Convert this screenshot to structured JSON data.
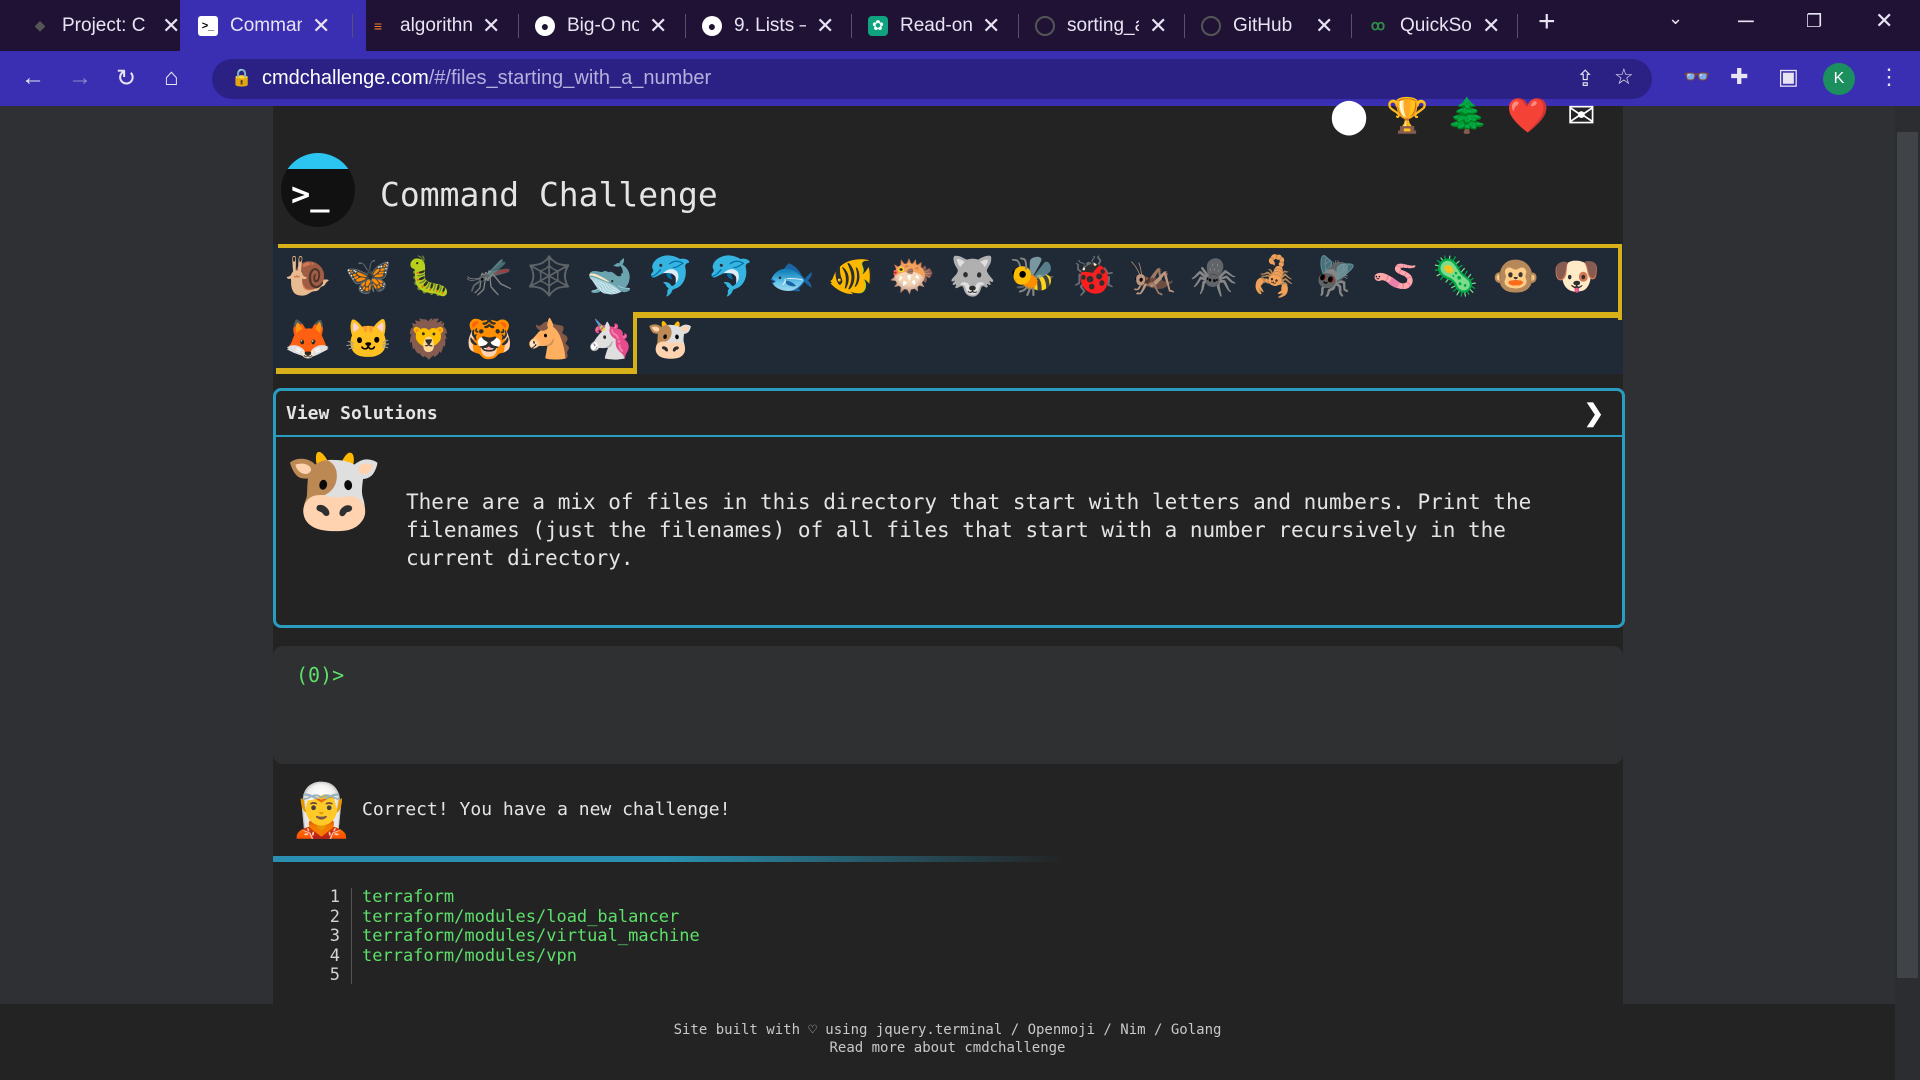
{
  "browser": {
    "tabs": [
      {
        "title": "Project: C",
        "favicon": "project-icon"
      },
      {
        "title": "Comman",
        "favicon": "terminal-icon",
        "active": true
      },
      {
        "title": "algorithn",
        "favicon": "stackoverflow-icon"
      },
      {
        "title": "Big-O no",
        "favicon": "globe-icon"
      },
      {
        "title": "9. Lists –",
        "favicon": "globe-icon"
      },
      {
        "title": "Read-onl",
        "favicon": "openai-icon"
      },
      {
        "title": "sorting_a",
        "favicon": "github-icon"
      },
      {
        "title": "GitHub",
        "favicon": "github-icon"
      },
      {
        "title": "QuickSor",
        "favicon": "geeksforgeeks-icon"
      }
    ],
    "new_tab": "+",
    "url": {
      "host": "cmdchallenge.com",
      "path": "/#/files_starting_with_a_number"
    },
    "profile_initial": "K",
    "colors": {
      "tab_strip": "#1f1235",
      "toolbar": "#3a2fb2",
      "omnibox": "#2b2185"
    }
  },
  "page": {
    "title": "Command Challenge",
    "logo_prompt": ">_",
    "top_icons": [
      "terminal-logo-icon",
      "trophy-hand-icon",
      "tree-icon",
      "heart-icon",
      "envelope-icon"
    ],
    "animals_row1": [
      "🐌",
      "🦋",
      "🐛",
      "🦟",
      "🕸️",
      "🐋",
      "🐬",
      "🐬",
      "🐟",
      "🐠",
      "🐡",
      "🐺",
      "🐝",
      "🐞",
      "🦗",
      "🕷️",
      "🦂",
      "🪰",
      "🪱",
      "🦠",
      "🐵",
      "🐶"
    ],
    "animals_row2": [
      "🦊",
      "🐱",
      "🦁",
      "🐯",
      "🐴",
      "🦄",
      "🐮"
    ],
    "solutions": {
      "title": "View Solutions",
      "chevron": "❯",
      "cow": "🐮",
      "description": "There are a mix of files in this directory that start with letters and numbers. Print the filenames (just the filenames) of all files that start with a number recursively in the current directory."
    },
    "terminal": {
      "prompt": "(0)>"
    },
    "result": {
      "elf": "🧝",
      "message": "Correct! You have a new challenge!",
      "lines": [
        {
          "n": "1",
          "text": "terraform"
        },
        {
          "n": "2",
          "text": "terraform/modules/load_balancer"
        },
        {
          "n": "3",
          "text": "terraform/modules/virtual_machine"
        },
        {
          "n": "4",
          "text": "terraform/modules/vpn"
        },
        {
          "n": "5",
          "text": ""
        }
      ]
    },
    "footer": {
      "line1": "Site built with ♡ using jquery.terminal / Openmoji / Nim / Golang",
      "line2": "Read more about cmdchallenge"
    },
    "colors": {
      "accent_blue": "#2a9cbf",
      "progress_yellow": "#d8b01a",
      "terminal_green": "#5de06a"
    }
  }
}
